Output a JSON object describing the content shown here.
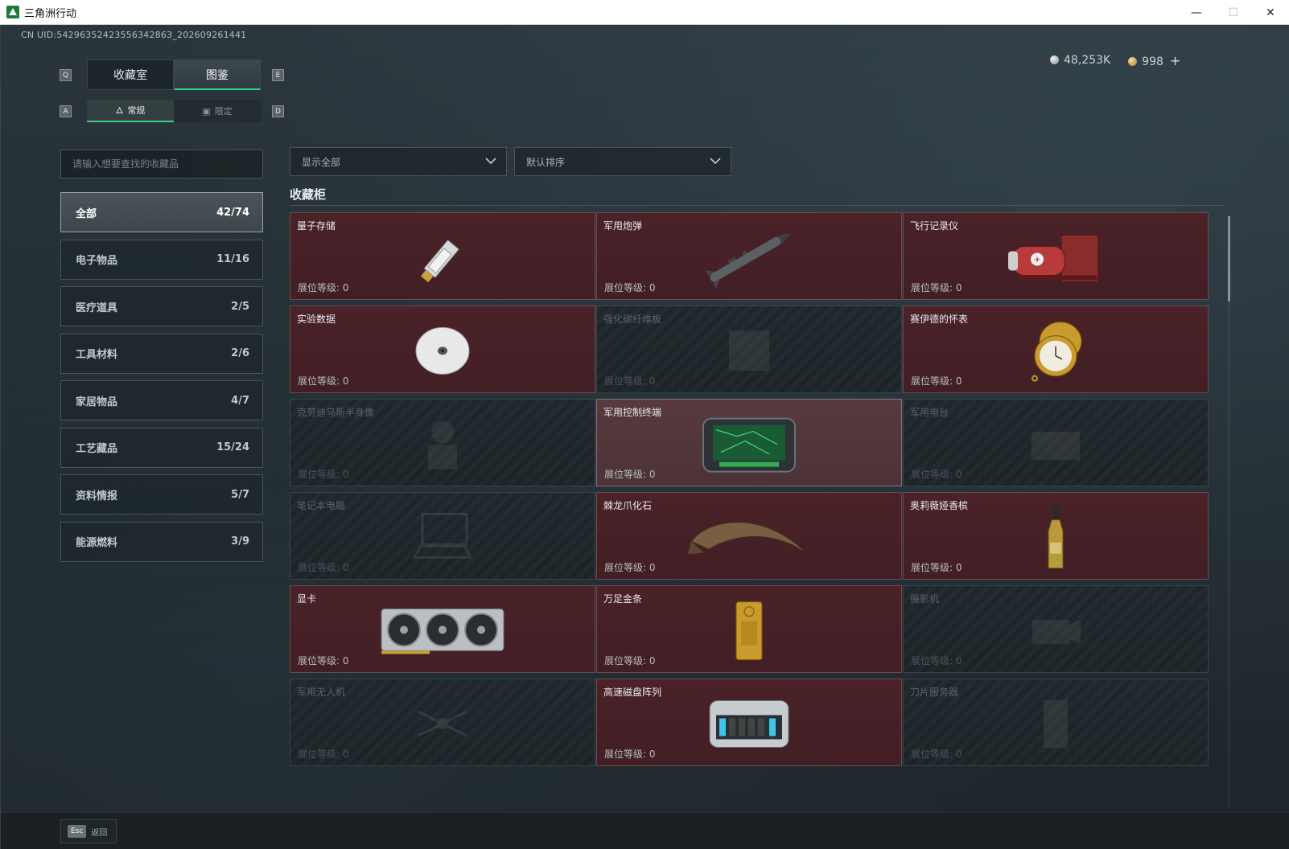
{
  "window": {
    "title": "三角洲行动",
    "controls": {
      "minimize": "—",
      "maximize": "☐",
      "close": "✕"
    }
  },
  "uid": "CN UID:5429635242355634286З_202609261441",
  "currency": {
    "silver": "48,253K",
    "gold": "998",
    "plus": "+"
  },
  "keys": {
    "prev_tab": "Q",
    "next_tab": "E",
    "prev_sub": "A",
    "next_sub": "D",
    "back": "Esc"
  },
  "tabs": [
    {
      "label": "收藏室",
      "active": false
    },
    {
      "label": "图鉴",
      "active": true
    }
  ],
  "subtabs": [
    {
      "label": "常规",
      "active": true,
      "icon": "bottle-icon"
    },
    {
      "label": "限定",
      "active": false,
      "icon": "image-icon"
    }
  ],
  "search": {
    "placeholder": "请输入想要查找的收藏品"
  },
  "filters": {
    "display": "显示全部",
    "sort": "默认排序"
  },
  "categories": [
    {
      "label": "全部",
      "count": "42/74",
      "active": true
    },
    {
      "label": "电子物品",
      "count": "11/16",
      "active": false
    },
    {
      "label": "医疗道具",
      "count": "2/5",
      "active": false
    },
    {
      "label": "工具材料",
      "count": "2/6",
      "active": false
    },
    {
      "label": "家居物品",
      "count": "4/7",
      "active": false
    },
    {
      "label": "工艺藏品",
      "count": "15/24",
      "active": false
    },
    {
      "label": "资料情报",
      "count": "5/7",
      "active": false
    },
    {
      "label": "能源燃料",
      "count": "3/9",
      "active": false
    }
  ],
  "section": {
    "title": "收藏柜"
  },
  "items": [
    {
      "name": "量子存储",
      "level": "展位等级: 0",
      "owned": true,
      "icon": "usb-drive-icon"
    },
    {
      "name": "军用炮弹",
      "level": "展位等级: 0",
      "owned": true,
      "icon": "missile-icon"
    },
    {
      "name": "飞行记录仪",
      "level": "展位等级: 0",
      "owned": true,
      "icon": "flight-recorder-icon"
    },
    {
      "name": "实验数据",
      "level": "展位等级: 0",
      "owned": true,
      "icon": "disc-icon"
    },
    {
      "name": "强化碳纤维板",
      "level": "展位等级: 0",
      "owned": false,
      "icon": "carbon-plate-icon"
    },
    {
      "name": "赛伊德的怀表",
      "level": "展位等级: 0",
      "owned": true,
      "icon": "pocket-watch-icon"
    },
    {
      "name": "克劳迪乌斯半身像",
      "level": "展位等级: 0",
      "owned": false,
      "icon": "bust-icon"
    },
    {
      "name": "军用控制终端",
      "level": "展位等级: 0",
      "owned": true,
      "highlight": true,
      "icon": "control-terminal-icon"
    },
    {
      "name": "军用电台",
      "level": "展位等级: 0",
      "owned": false,
      "icon": "radio-icon"
    },
    {
      "name": "笔记本电脑",
      "level": "展位等级: 0",
      "owned": false,
      "icon": "laptop-icon"
    },
    {
      "name": "棘龙爪化石",
      "level": "展位等级: 0",
      "owned": true,
      "icon": "claw-fossil-icon"
    },
    {
      "name": "奥莉薇娅香槟",
      "level": "展位等级: 0",
      "owned": true,
      "icon": "champagne-icon"
    },
    {
      "name": "显卡",
      "level": "展位等级: 0",
      "owned": true,
      "icon": "graphics-card-icon"
    },
    {
      "name": "万足金条",
      "level": "展位等级: 0",
      "owned": true,
      "icon": "gold-bar-icon"
    },
    {
      "name": "摄影机",
      "level": "展位等级: 0",
      "owned": false,
      "icon": "camera-icon"
    },
    {
      "name": "军用无人机",
      "level": "展位等级: 0",
      "owned": false,
      "icon": "drone-icon"
    },
    {
      "name": "高速磁盘阵列",
      "level": "展位等级: 0",
      "owned": true,
      "icon": "disk-array-icon"
    },
    {
      "name": "刀片服务器",
      "level": "展位等级: 0",
      "owned": false,
      "icon": "blade-server-icon"
    }
  ],
  "bottom": {
    "back_label": "返回"
  },
  "colors": {
    "accent": "#35d08a",
    "owned_card": "#4a2228",
    "locked_card": "#1f272c"
  }
}
